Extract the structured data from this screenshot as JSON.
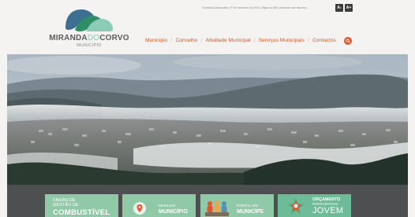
{
  "header": {
    "topinfo": "Condeixa Quarta-feira, 27 de novembro de 2019 | Mapa do Site | Adicionar aos favoritos",
    "font_decrease": "A-",
    "font_increase": "A+",
    "logo": {
      "name_part1": "MIRANDA",
      "name_part2": "DO",
      "name_part3": "CORVO",
      "subtitle": "MUNICÍPIO"
    }
  },
  "nav": {
    "items": [
      {
        "label": "Município"
      },
      {
        "label": "Concelho"
      },
      {
        "label": "Atividade Municipal"
      },
      {
        "label": "Serviços Municipais"
      },
      {
        "label": "Contactos"
      }
    ],
    "search_icon": "search-icon"
  },
  "hero": {
    "description_icon": "landscape-photo"
  },
  "tiles": [
    {
      "line1": "FAIXAS DE",
      "line2": "GESTÃO DE",
      "line3": "COMBUSTÍVEL",
      "bg": "#8fc9a8",
      "icon": "none"
    },
    {
      "line1": "MAPA DO",
      "line2": "MUNICÍPIO",
      "bg": "#8fc9a8",
      "icon": "map-pin-icon"
    },
    {
      "line1": "PORTAL DO",
      "line2": "MUNICÍPE",
      "bg": "#8fc9a8",
      "icon": "people-icon"
    },
    {
      "line1": "ORÇAMENTO",
      "line2": "PARTICIPATIVO",
      "line3": "JOVEM",
      "bg": "#6dbb97",
      "icon": "star-logo-icon"
    }
  ],
  "colors": {
    "accent": "#e0552b",
    "nav_text": "#d35a2a",
    "strip": "#4e4f51",
    "logo_blue": "#3d6f93",
    "logo_green": "#8ccbb6"
  }
}
